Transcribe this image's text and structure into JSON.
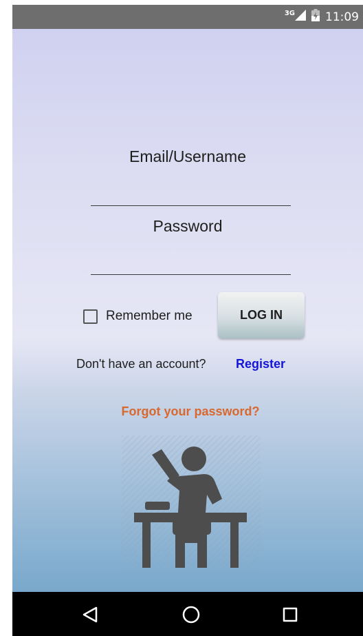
{
  "status_bar": {
    "network_label": "3G",
    "time": "11:09",
    "icons": [
      "signal-icon",
      "battery-icon"
    ]
  },
  "login_form": {
    "email_label": "Email/Username",
    "email_value": "",
    "password_label": "Password",
    "password_value": "",
    "remember_label": "Remember me",
    "remember_checked": false,
    "login_button": "LOG IN"
  },
  "register_prompt": {
    "text": "Don't have an account?",
    "link": "Register"
  },
  "forgot_password": "Forgot your password?",
  "illustration_icon": "student-at-desk-icon",
  "nav_bar": {
    "icons": [
      "back-icon",
      "home-icon",
      "recents-icon"
    ]
  },
  "colors": {
    "register_link": "#1515d9",
    "forgot_link": "#d9682e",
    "status_bar": "#6e6e6e",
    "nav_bar": "#000000"
  }
}
